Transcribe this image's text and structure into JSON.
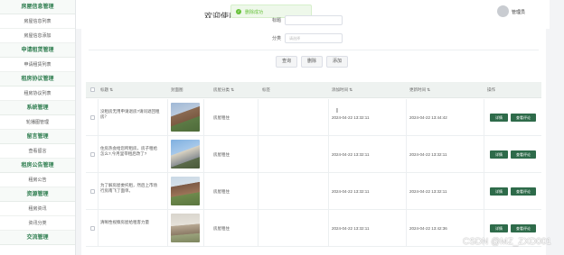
{
  "sidebar": {
    "groups": [
      {
        "head": "房屋信息管理",
        "subs": [
          "房屋信息列表",
          "房屋信息添加"
        ]
      },
      {
        "head": "申请租赁管理",
        "subs": [
          "申请租赁列表"
        ]
      },
      {
        "head": "租房协议管理",
        "subs": [
          "租房协议列表"
        ]
      },
      {
        "head": "系统管理",
        "subs": [
          "轮播图管理"
        ]
      },
      {
        "head": "留言管理",
        "subs": [
          "查看留言"
        ]
      },
      {
        "head": "租房公告管理",
        "subs": [
          "租房公告"
        ]
      },
      {
        "head": "资源管理",
        "subs": [
          "租房资讯",
          "资讯分类"
        ]
      },
      {
        "head": "交流管理",
        "subs": []
      }
    ]
  },
  "topbar": {
    "title": "欢迎使用",
    "toast": "删除成功",
    "user": "管理员"
  },
  "filters": {
    "name_label": "标题",
    "category_label": "分类",
    "category_placeholder": "请选择"
  },
  "buttons": {
    "query": "查询",
    "delete": "删除",
    "add": "添加"
  },
  "table": {
    "headers": [
      "标题",
      "封面图",
      "房屋分类",
      "标签",
      "添加时间",
      "更新时间",
      "操作"
    ],
    "sort_glyph": "⇅",
    "rows": [
      {
        "title": "没租房无用申请退房?请问退回租房？",
        "category": "房屋租住",
        "added": "2024-04-22 13:32:11",
        "updated": "2024-04-22 13:44:42"
      },
      {
        "title": "住房热会给您所租房，房子租给怎么?,今月里带租后改了?",
        "category": "房屋租住",
        "added": "2024-04-22 13:32:11",
        "updated": "2024-04-22 13:32:11"
      },
      {
        "title": "为了解房屋委托租，然后上市场行房南飞了面单。",
        "category": "房屋租住",
        "added": "2024-04-22 13:32:11",
        "updated": "2024-04-22 13:32:11"
      },
      {
        "title": "清晰性视察房屋给租客力量",
        "category": "房屋租住",
        "added": "2024-04-22 13:32:11",
        "updated": "2024-04-22 13:42:36"
      }
    ],
    "action_detail": "详情",
    "action_comments": "查看评论"
  },
  "watermark": "CSDN @MZ_ZXD001",
  "colors": {
    "accent": "#2e6b4a",
    "menu_head": "#2e7d4f",
    "toast_green": "#67c23a"
  }
}
